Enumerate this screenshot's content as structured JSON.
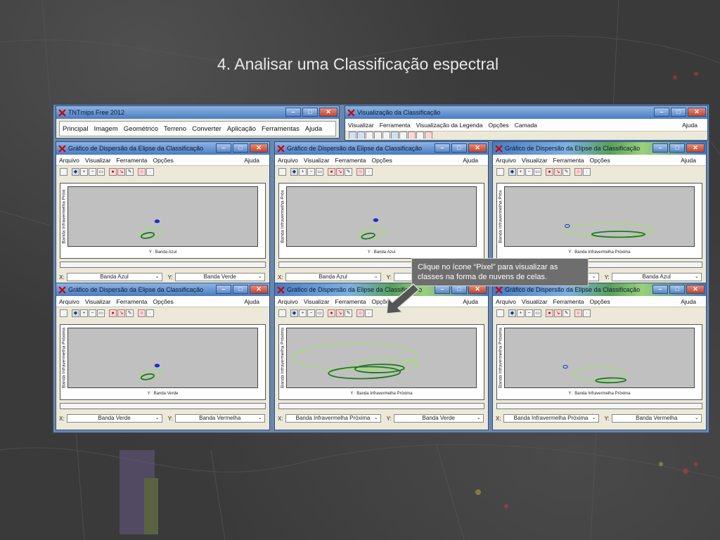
{
  "slide": {
    "title": "4. Analisar uma Classificação espectral"
  },
  "main_window": {
    "title": "TNTmips Free 2012",
    "menu": [
      "Principal",
      "Imagem",
      "Geométrico",
      "Terreno",
      "Converter",
      "Aplicação",
      "Ferramentas",
      "Ajuda"
    ]
  },
  "view_window": {
    "title": "Visualização da Classificação",
    "menu": [
      "Visualizar",
      "Ferramenta",
      "Visualização da Legenda",
      "Opções",
      "Camada"
    ],
    "menu_right": "Ajuda"
  },
  "scatter_window": {
    "title": "Gráfico de Dispersão da Elipse da Classificação",
    "menu": [
      "Arquivo",
      "Visualizar",
      "Ferramenta",
      "Opções"
    ],
    "menu_right": "Ajuda",
    "x_prefix": "X:",
    "y_prefix": "Y:"
  },
  "plots": [
    {
      "ylabel": "Banda Infravermelha Próxi",
      "xlabel": "Y : Banda Azul",
      "x_combo": "Banda Azul",
      "y_combo": "Banda Verde"
    },
    {
      "ylabel": "Banda Infravermelha Próx",
      "xlabel": "Y : Banda Azul",
      "x_combo": "Banda Azul",
      "y_combo": ""
    },
    {
      "ylabel": "Banda Infravermelha Próx",
      "xlabel": "Y : Banda Infravermelha Próxima",
      "x_combo": "",
      "y_combo": "Banda Azul"
    },
    {
      "ylabel": "Banda Infravermelha Próxima",
      "xlabel": "Y : Banda Verde",
      "x_combo": "Banda Verde",
      "y_combo": "Banda Vermelha"
    },
    {
      "ylabel": "Banda Infravermelha Próxima",
      "xlabel": "Y : Banda Infravermelha Próxima",
      "x_combo": "Banda Infravermelha Próxima",
      "y_combo": "Banda Verde"
    },
    {
      "ylabel": "Banda Infravermelha Próxima",
      "xlabel": "Y : Banda Infravermelha Próxima",
      "x_combo": "Banda Infravermelha Próxima",
      "y_combo": "Banda Vermelha"
    }
  ],
  "callout": {
    "text": "Clique no ícone “Pixel” para visualizar as classes na forma de nuvens de celas."
  },
  "colors": {
    "ellipse_light": "#9be26a",
    "ellipse_dark": "#1f7a1f",
    "point_blue": "#1a2fd0",
    "plot_bg": "#c0c0c0"
  },
  "icons": [
    "app-logo-icon",
    "new-document-icon",
    "zoom-in-icon",
    "zoom-out-icon",
    "pixel-icon",
    "minimize-icon",
    "maximize-icon",
    "close-icon"
  ]
}
